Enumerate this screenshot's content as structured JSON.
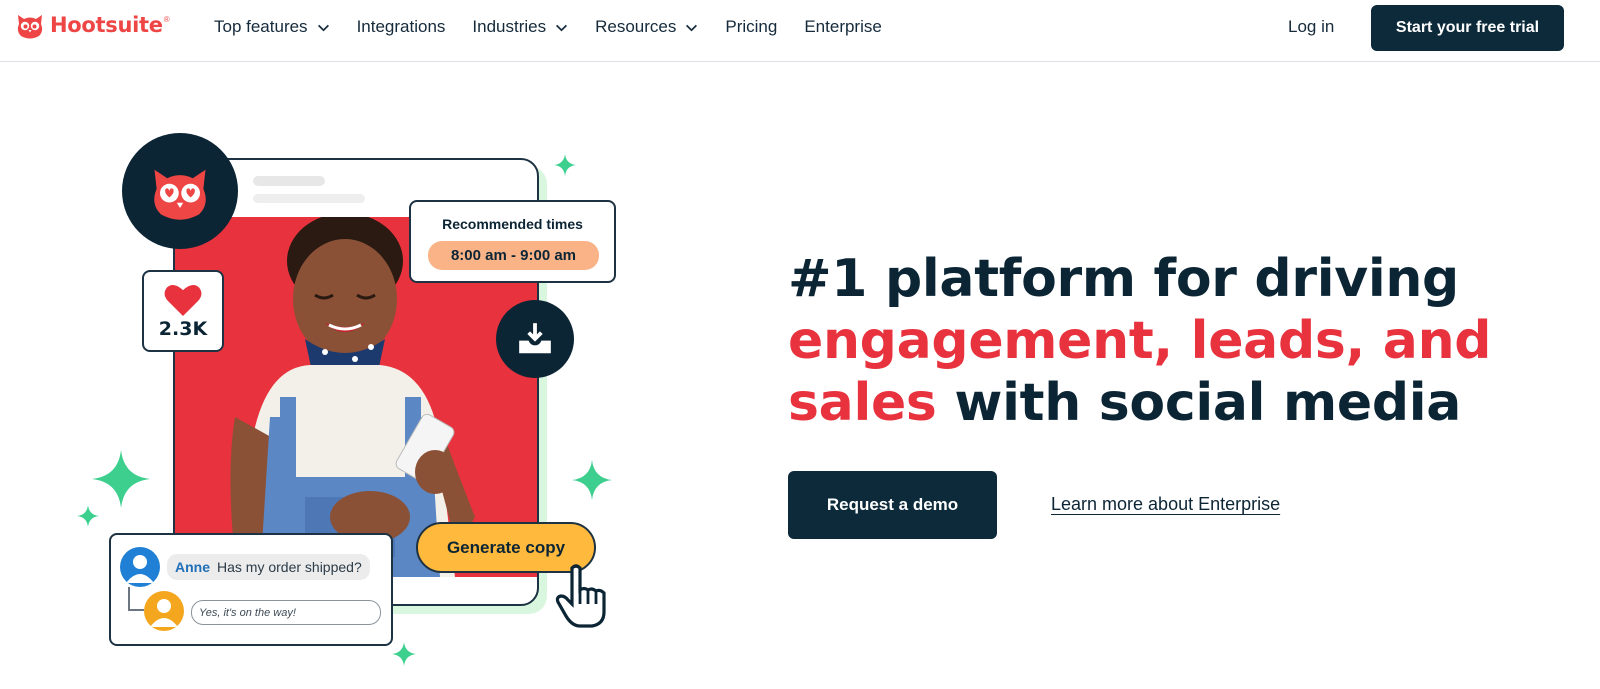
{
  "brand": {
    "name": "Hootsuite",
    "tm": "®",
    "color": "#ee4545"
  },
  "nav": {
    "items": [
      {
        "label": "Top features",
        "has_dropdown": true
      },
      {
        "label": "Integrations",
        "has_dropdown": false
      },
      {
        "label": "Industries",
        "has_dropdown": true
      },
      {
        "label": "Resources",
        "has_dropdown": true
      },
      {
        "label": "Pricing",
        "has_dropdown": false
      },
      {
        "label": "Enterprise",
        "has_dropdown": false
      }
    ],
    "login_label": "Log in",
    "trial_label": "Start your free trial"
  },
  "hero": {
    "headline_part1": "#1 platform for driving",
    "headline_red1": "engagement, leads, and",
    "headline_red2": "sales",
    "headline_part2": " with social media",
    "demo_label": "Request a demo",
    "learn_more_label": "Learn more about Enterprise",
    "accent_red": "#e8323d",
    "navy": "#0c2535"
  },
  "illustration": {
    "like_count": "2.3K",
    "recommended_title": "Recommended times",
    "recommended_time": "8:00 am - 9:00 am",
    "generate_label": "Generate copy",
    "chat_name": "Anne",
    "chat_message": "Has my order shipped?",
    "chat_reply": "Yes, it's on the way!",
    "icons": [
      "owl-icon",
      "heart-icon",
      "inbox-download-icon",
      "pointer-cursor-icon",
      "sparkle-icon"
    ]
  }
}
